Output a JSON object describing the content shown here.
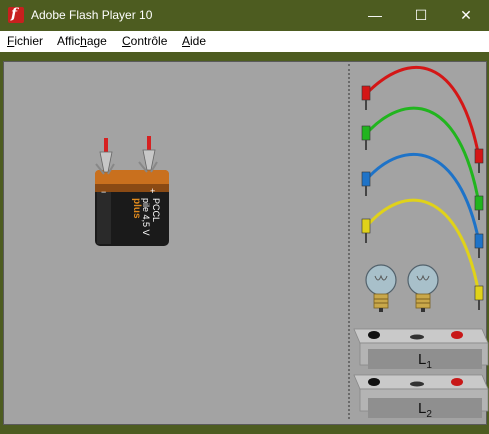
{
  "window": {
    "title": "Adobe Flash Player 10",
    "controls": {
      "minimize": "—",
      "maximize": "☐",
      "close": "✕"
    }
  },
  "menu": [
    {
      "label": "Fichier",
      "accel": "F",
      "rest": "ichier"
    },
    {
      "label": "Affichage",
      "pre": "Affic",
      "accel": "h",
      "rest": "age"
    },
    {
      "label": "Contrôle",
      "accel": "C",
      "rest": "ontrôle"
    },
    {
      "label": "Aide",
      "accel": "A",
      "rest": "ide"
    }
  ],
  "battery": {
    "brand": "PCCL",
    "line2": "pile 4,5 V",
    "line3": "plus",
    "minus_sign": "−",
    "plus_sign": "+"
  },
  "wires": [
    {
      "color": "#d41616"
    },
    {
      "color": "#21b51e"
    },
    {
      "color": "#1e73c8"
    },
    {
      "color": "#e0d21a"
    }
  ],
  "lamp_holders": [
    {
      "name": "L",
      "sub": "1"
    },
    {
      "name": "L",
      "sub": "2"
    }
  ]
}
